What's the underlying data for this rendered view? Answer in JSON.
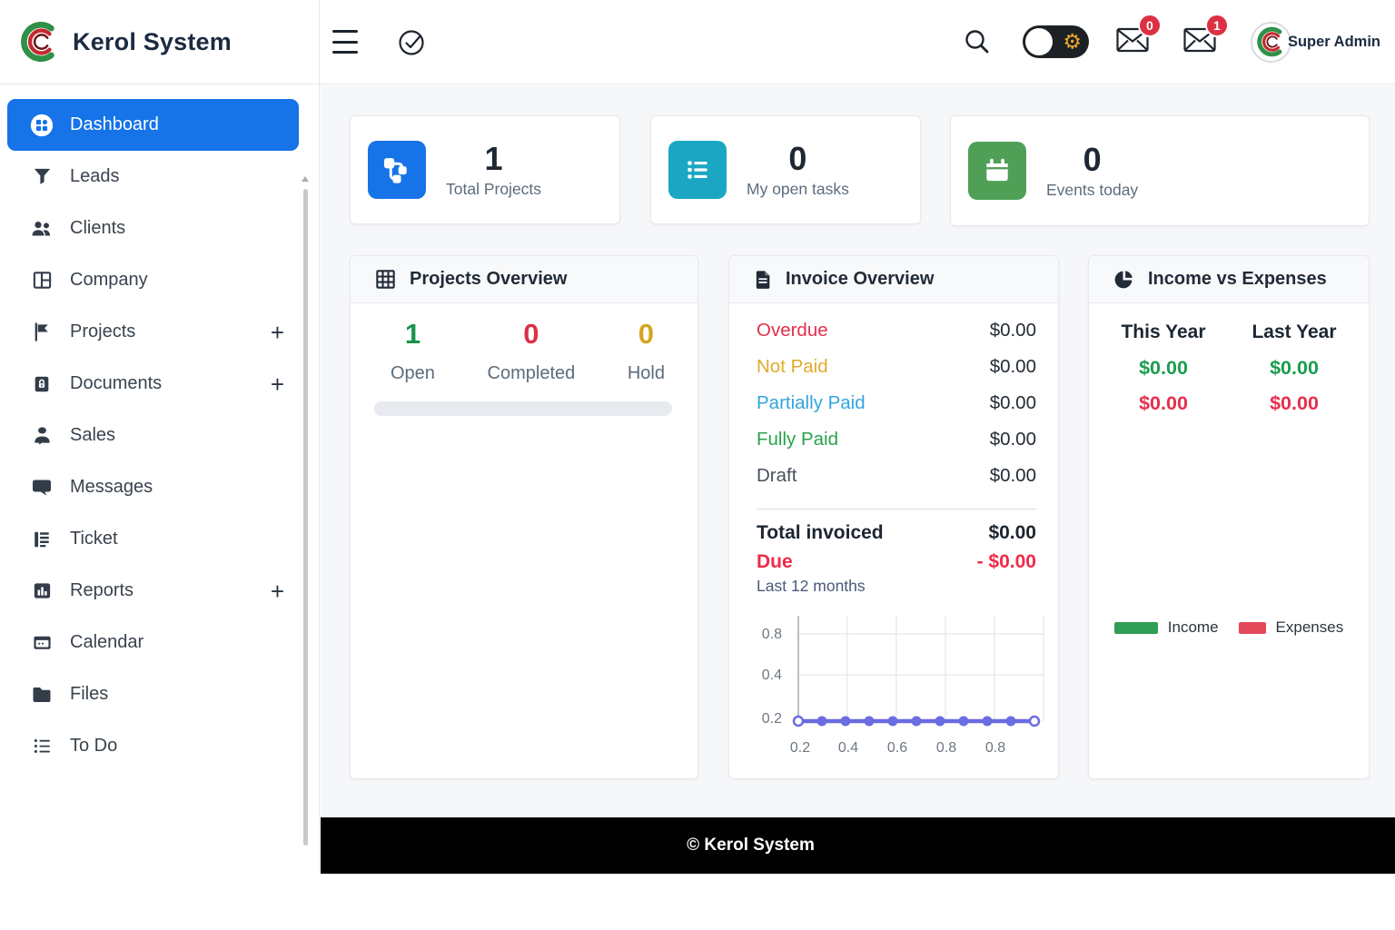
{
  "header": {
    "brand": "Kerol System",
    "user": "Super Admin",
    "toggle_gear": "⚙",
    "badge_left": "0",
    "badge_right": "1"
  },
  "sidebar": {
    "items": [
      {
        "label": "Dashboard",
        "active": true
      },
      {
        "label": "Leads"
      },
      {
        "label": "Clients"
      },
      {
        "label": "Company"
      },
      {
        "label": "Projects",
        "plus": "+"
      },
      {
        "label": "Documents",
        "plus": "+"
      },
      {
        "label": "Sales"
      },
      {
        "label": "Messages"
      },
      {
        "label": "Ticket"
      },
      {
        "label": "Reports",
        "plus": "+"
      },
      {
        "label": "Calendar"
      },
      {
        "label": "Files"
      },
      {
        "label": "To Do"
      }
    ]
  },
  "stats": [
    {
      "value": "1",
      "label": "Total Projects",
      "icon": "project-branch-icon",
      "tile_color": "#1673e8"
    },
    {
      "value": "0",
      "label": "My open tasks",
      "icon": "task-list-icon",
      "tile_color": "#1ba7c4"
    },
    {
      "value": "0",
      "label": "Events today",
      "icon": "calendar-icon",
      "tile_color": "#4f9f57"
    }
  ],
  "projects_overview": {
    "title": "Projects Overview",
    "stats": [
      {
        "value": "1",
        "label": "Open",
        "color": "#17934a"
      },
      {
        "value": "0",
        "label": "Completed",
        "color": "#dc2f45"
      },
      {
        "value": "0",
        "label": "Hold",
        "color": "#d6a51f"
      }
    ]
  },
  "invoice_overview": {
    "title": "Invoice Overview",
    "rows": [
      {
        "label": "Overdue",
        "value": "$0.00",
        "color": "#e3304b"
      },
      {
        "label": "Not Paid",
        "value": "$0.00",
        "color": "#e2aa2e"
      },
      {
        "label": "Partially Paid",
        "value": "$0.00",
        "color": "#33a4de"
      },
      {
        "label": "Fully Paid",
        "value": "$0.00",
        "color": "#2aa24c"
      },
      {
        "label": "Draft",
        "value": "$0.00",
        "color": "#45505c"
      }
    ],
    "total_label": "Total invoiced",
    "total_value": "$0.00",
    "due_label": "Due",
    "due_value": "- $0.00",
    "chart_caption": "Last 12 months"
  },
  "income_expenses": {
    "title": "Income vs Expenses",
    "col1": "This Year",
    "col2": "Last Year",
    "income_this": "$0.00",
    "income_last": "$0.00",
    "expense_this": "$0.00",
    "expense_last": "$0.00",
    "legend": [
      {
        "label": "Income",
        "color": "#2f9e54"
      },
      {
        "label": "Expenses",
        "color": "#e4495b"
      }
    ]
  },
  "chart_data": {
    "type": "line",
    "title": "Last 12 months",
    "x_ticks": [
      "0.2",
      "0.4",
      "0.6",
      "0.8",
      "0.8"
    ],
    "y_ticks": [
      "0.8",
      "0.4",
      "0.2"
    ],
    "values": [
      0.2,
      0.2,
      0.2,
      0.2,
      0.2,
      0.2,
      0.2,
      0.2,
      0.2,
      0.2,
      0.2
    ],
    "ylim": [
      0.2,
      1.0
    ],
    "grid": true,
    "legend_position": "none",
    "line_color": "#6a6ce0"
  },
  "footer": {
    "text": "© Kerol System"
  }
}
